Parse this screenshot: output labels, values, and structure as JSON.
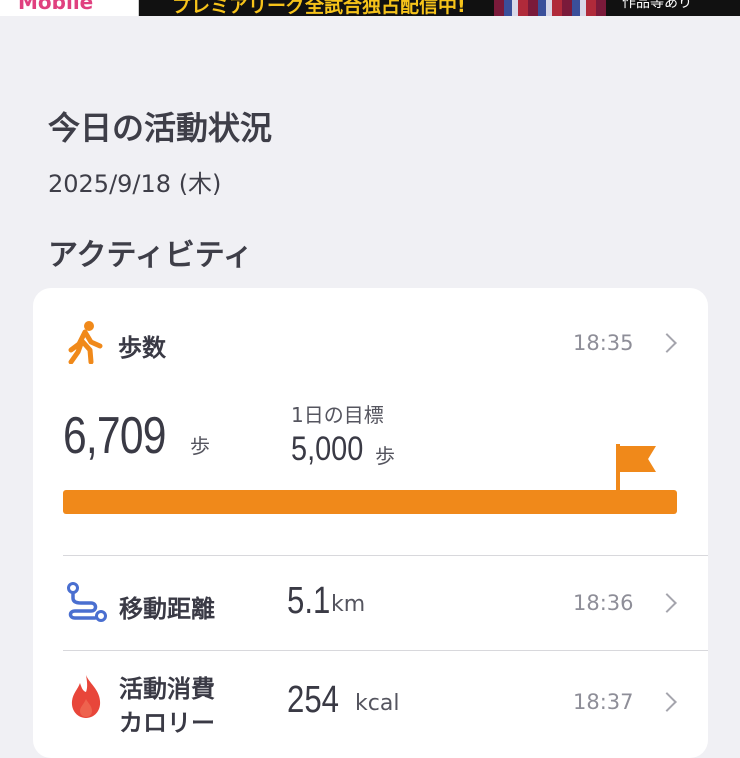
{
  "ad": {
    "logo_text": "Mobile",
    "headline": "プレミアリーグ全試合独占配信中!",
    "note": "作品等あり"
  },
  "header": {
    "title": "今日の活動状況",
    "date": "2025/9/18 (木)"
  },
  "activity": {
    "section_title": "アクティビティ",
    "steps": {
      "icon": "walking-person-icon",
      "label": "歩数",
      "time": "18:35",
      "value": "6,709",
      "unit": "歩",
      "goal_label": "1日の目標",
      "goal_value": "5,000",
      "goal_unit": "歩",
      "progress": 1.0
    },
    "distance": {
      "icon": "route-icon",
      "label": "移動距離",
      "value": "5.1",
      "unit": "km",
      "time": "18:36"
    },
    "calories": {
      "icon": "flame-icon",
      "label_line1": "活動消費",
      "label_line2": "カロリー",
      "value": "254",
      "unit": "kcal",
      "time": "18:37"
    }
  },
  "colors": {
    "accent": "#f0891a",
    "distance_icon": "#4a6fd0",
    "flame_icon": "#e8463a",
    "background": "#f0f0f4"
  }
}
